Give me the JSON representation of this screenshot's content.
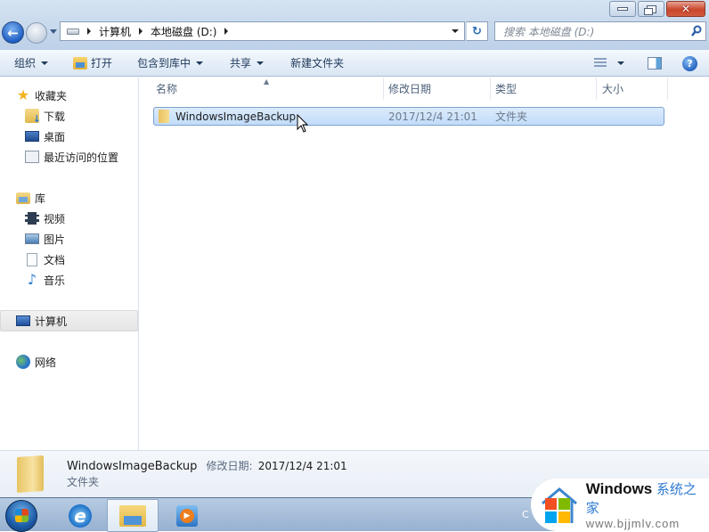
{
  "window": {
    "controls": {
      "minimize": "minimize",
      "maximize": "restore",
      "close": "close"
    }
  },
  "address_bar": {
    "crumbs": [
      "计算机",
      "本地磁盘 (D:)"
    ],
    "search_placeholder": "搜索 本地磁盘 (D:)"
  },
  "toolbar": {
    "organize": "组织",
    "open": "打开",
    "include_in_library": "包含到库中",
    "share": "共享",
    "new_folder": "新建文件夹"
  },
  "nav_pane": {
    "favorites": {
      "label": "收藏夹",
      "items": [
        "下载",
        "桌面",
        "最近访问的位置"
      ]
    },
    "libraries": {
      "label": "库",
      "items": [
        "视频",
        "图片",
        "文档",
        "音乐"
      ]
    },
    "computer": "计算机",
    "network": "网络"
  },
  "file_list": {
    "columns": [
      "名称",
      "修改日期",
      "类型",
      "大小"
    ],
    "rows": [
      {
        "name": "WindowsImageBackup",
        "modified": "2017/12/4 21:01",
        "type": "文件夹",
        "size": ""
      }
    ]
  },
  "details_pane": {
    "name": "WindowsImageBackup",
    "modified_label": "修改日期:",
    "modified": "2017/12/4 21:01",
    "type": "文件夹"
  },
  "taskbar": {
    "tray_text": "C"
  },
  "watermark": {
    "brand": "Windows",
    "brand_cn": "系统之家",
    "url": "www.bjjmlv.com"
  }
}
